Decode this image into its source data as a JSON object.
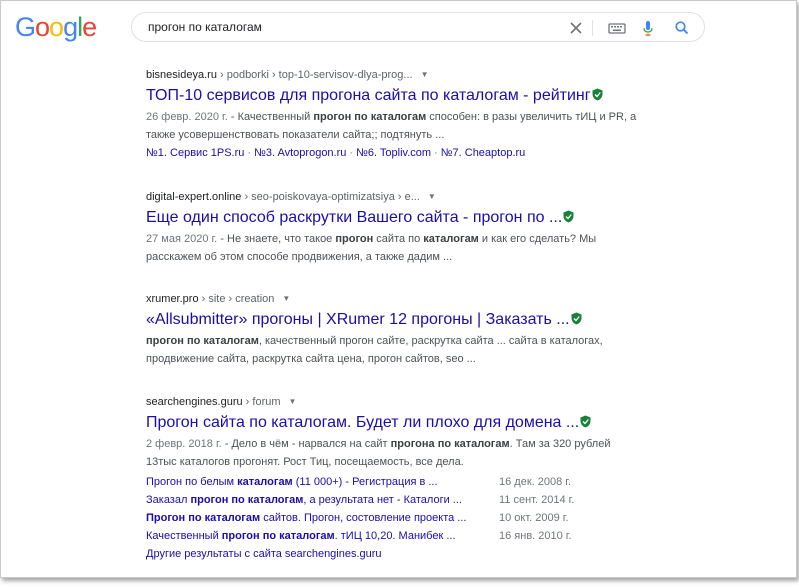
{
  "logo": {
    "letters": [
      "G",
      "o",
      "o",
      "g",
      "l",
      "e"
    ],
    "colors": [
      "#4285f4",
      "#ea4335",
      "#fbbc05",
      "#4285f4",
      "#34a853",
      "#ea4335"
    ]
  },
  "search": {
    "value": "прогон по каталогам"
  },
  "colors": {
    "link": "#1a0dab",
    "text": "#4d5156",
    "shield": "#188038"
  },
  "results": [
    {
      "domain": "bisnesideya.ru",
      "path": " › podborki › top-10-servisov-dlya-prog...",
      "title": "ТОП-10 сервисов для прогона сайта по каталогам - рейтинг",
      "date": "26 февр. 2020 г.",
      "snippet_parts": [
        " - Качественный ",
        "прогон по каталогам",
        " способен: в разы увеличить тИЦ и PR, а также усовершенствовать показатели сайта;; подтянуть ..."
      ],
      "sitelinks": [
        "№1. Сервис 1PS.ru",
        "№3. Avtoprogon.ru",
        "№6. Topliv.com",
        "№7. Cheaptop.ru"
      ]
    },
    {
      "domain": "digital-expert.online",
      "path": " › seo-poiskovaya-optimizatsiya › e...",
      "title": "Еще один способ раскрутки Вашего сайта - прогон по ...",
      "date": "27 мая 2020 г.",
      "snippet_parts": [
        " - Не знаете, что такое ",
        "прогон",
        " сайта по ",
        "каталогам",
        " и как его сделать? Мы расскажем об этом способе продвижения, а также дадим ..."
      ]
    },
    {
      "domain": "xrumer.pro",
      "path": " › site › creation",
      "title": "«Allsubmitter» прогоны | XRumer 12 прогоны | Заказать ...",
      "snippet_parts": [
        "прогон по каталогам",
        ", качественный прогон сайте, раскрутка сайта ... сайта в каталогах, продвижение сайта, раскрутка сайта цена, прогон сайтов, seo ..."
      ]
    },
    {
      "domain": "searchengines.guru",
      "path": " › forum",
      "title": "Прогон сайта по каталогам. Будет ли плохо для домена ...",
      "date": "2 февр. 2018 г.",
      "snippet_parts": [
        " - Дело в чём - нарвался на сайт ",
        "прогона по каталогам",
        ". Там за 320 рублей 13тыс каталогов прогонят. Рост Тиц, посещаемость, все дела."
      ],
      "subresults": [
        {
          "pre": "Прогон",
          "mid1": " по белым ",
          "bold1": "каталогам",
          "rest": " (11 000+) - Регистрация в ...",
          "date": "16 дек. 2008 г."
        },
        {
          "pre": "Заказал ",
          "bold1": "прогон по каталогам",
          "rest": ", а результата нет - Каталоги ...",
          "date": "11 сент. 2014 г."
        },
        {
          "pre": "",
          "bold1": "Прогон по каталогам",
          "rest": " сайтов. Прогон, состовление проекта ...",
          "date": "10 окт. 2009 г."
        },
        {
          "pre": "Качественный ",
          "bold1": "прогон по каталогам",
          "rest": ". тИЦ 10,20. Манибек ...",
          "date": "16 янв. 2010 г."
        }
      ],
      "more": "Другие результаты с сайта searchengines.guru"
    }
  ]
}
